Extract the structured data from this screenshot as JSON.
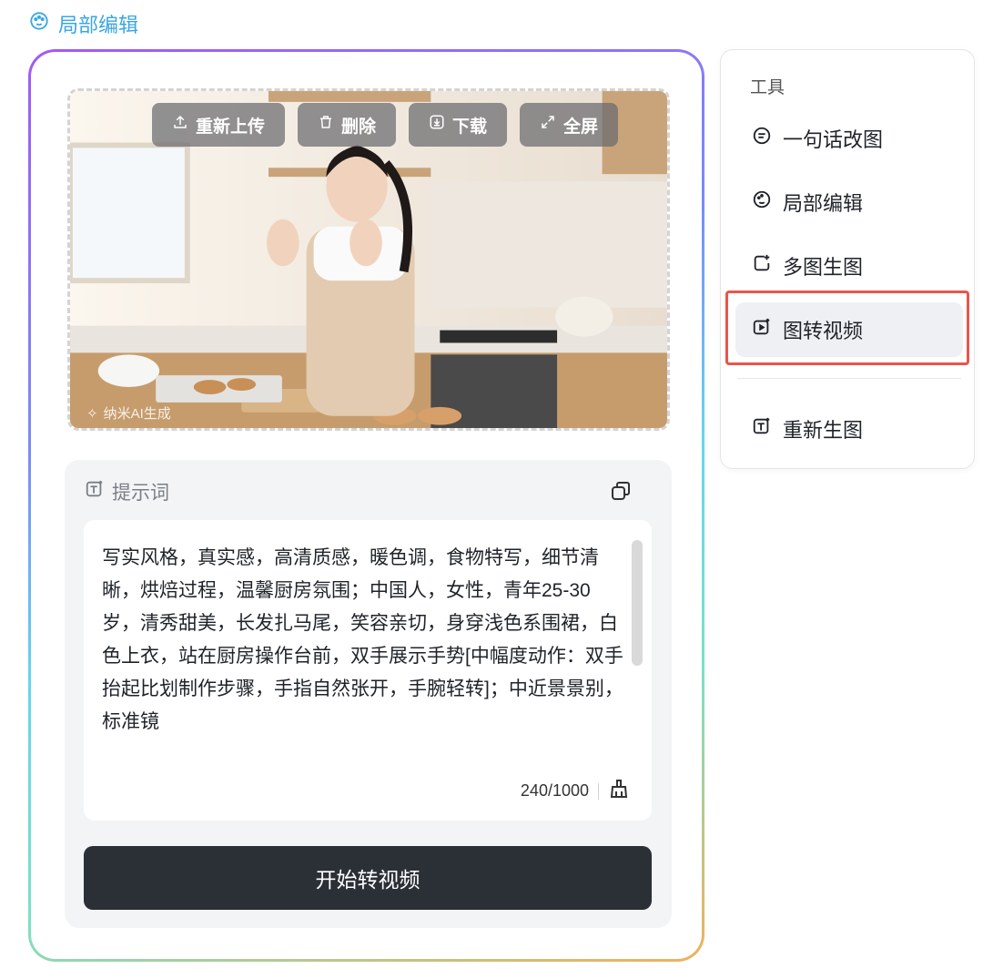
{
  "header": {
    "title": "局部编辑",
    "icon": "palette-icon",
    "color": "#3aa6e6"
  },
  "image_toolbar": {
    "reupload": "重新上传",
    "delete": "删除",
    "download": "下载",
    "fullscreen": "全屏"
  },
  "image": {
    "watermark": "纳米AI生成"
  },
  "prompt": {
    "label": "提示词",
    "text": "写实风格，真实感，高清质感，暖色调，食物特写，细节清晰，烘焙过程，温馨厨房氛围；中国人，女性，青年25-30岁，清秀甜美，长发扎马尾，笑容亲切，身穿浅色系围裙，白色上衣，站在厨房操作台前，双手展示手势[中幅度动作：双手抬起比划制作步骤，手指自然张开，手腕轻转]；中近景景别，标准镜",
    "counter": "240/1000"
  },
  "start_button": "开始转视频",
  "tools": {
    "title": "工具",
    "items": [
      {
        "label": "一句话改图",
        "icon": "chat-bubble-icon"
      },
      {
        "label": "局部编辑",
        "icon": "palette-icon"
      },
      {
        "label": "多图生图",
        "icon": "multi-image-icon"
      },
      {
        "label": "图转视频",
        "icon": "video-icon",
        "active": true
      },
      {
        "label": "重新生图",
        "icon": "text-image-icon"
      }
    ]
  },
  "colors": {
    "highlight": "#e8554e",
    "start_button_bg": "#2b2f36",
    "accent": "#3aa6e6"
  }
}
